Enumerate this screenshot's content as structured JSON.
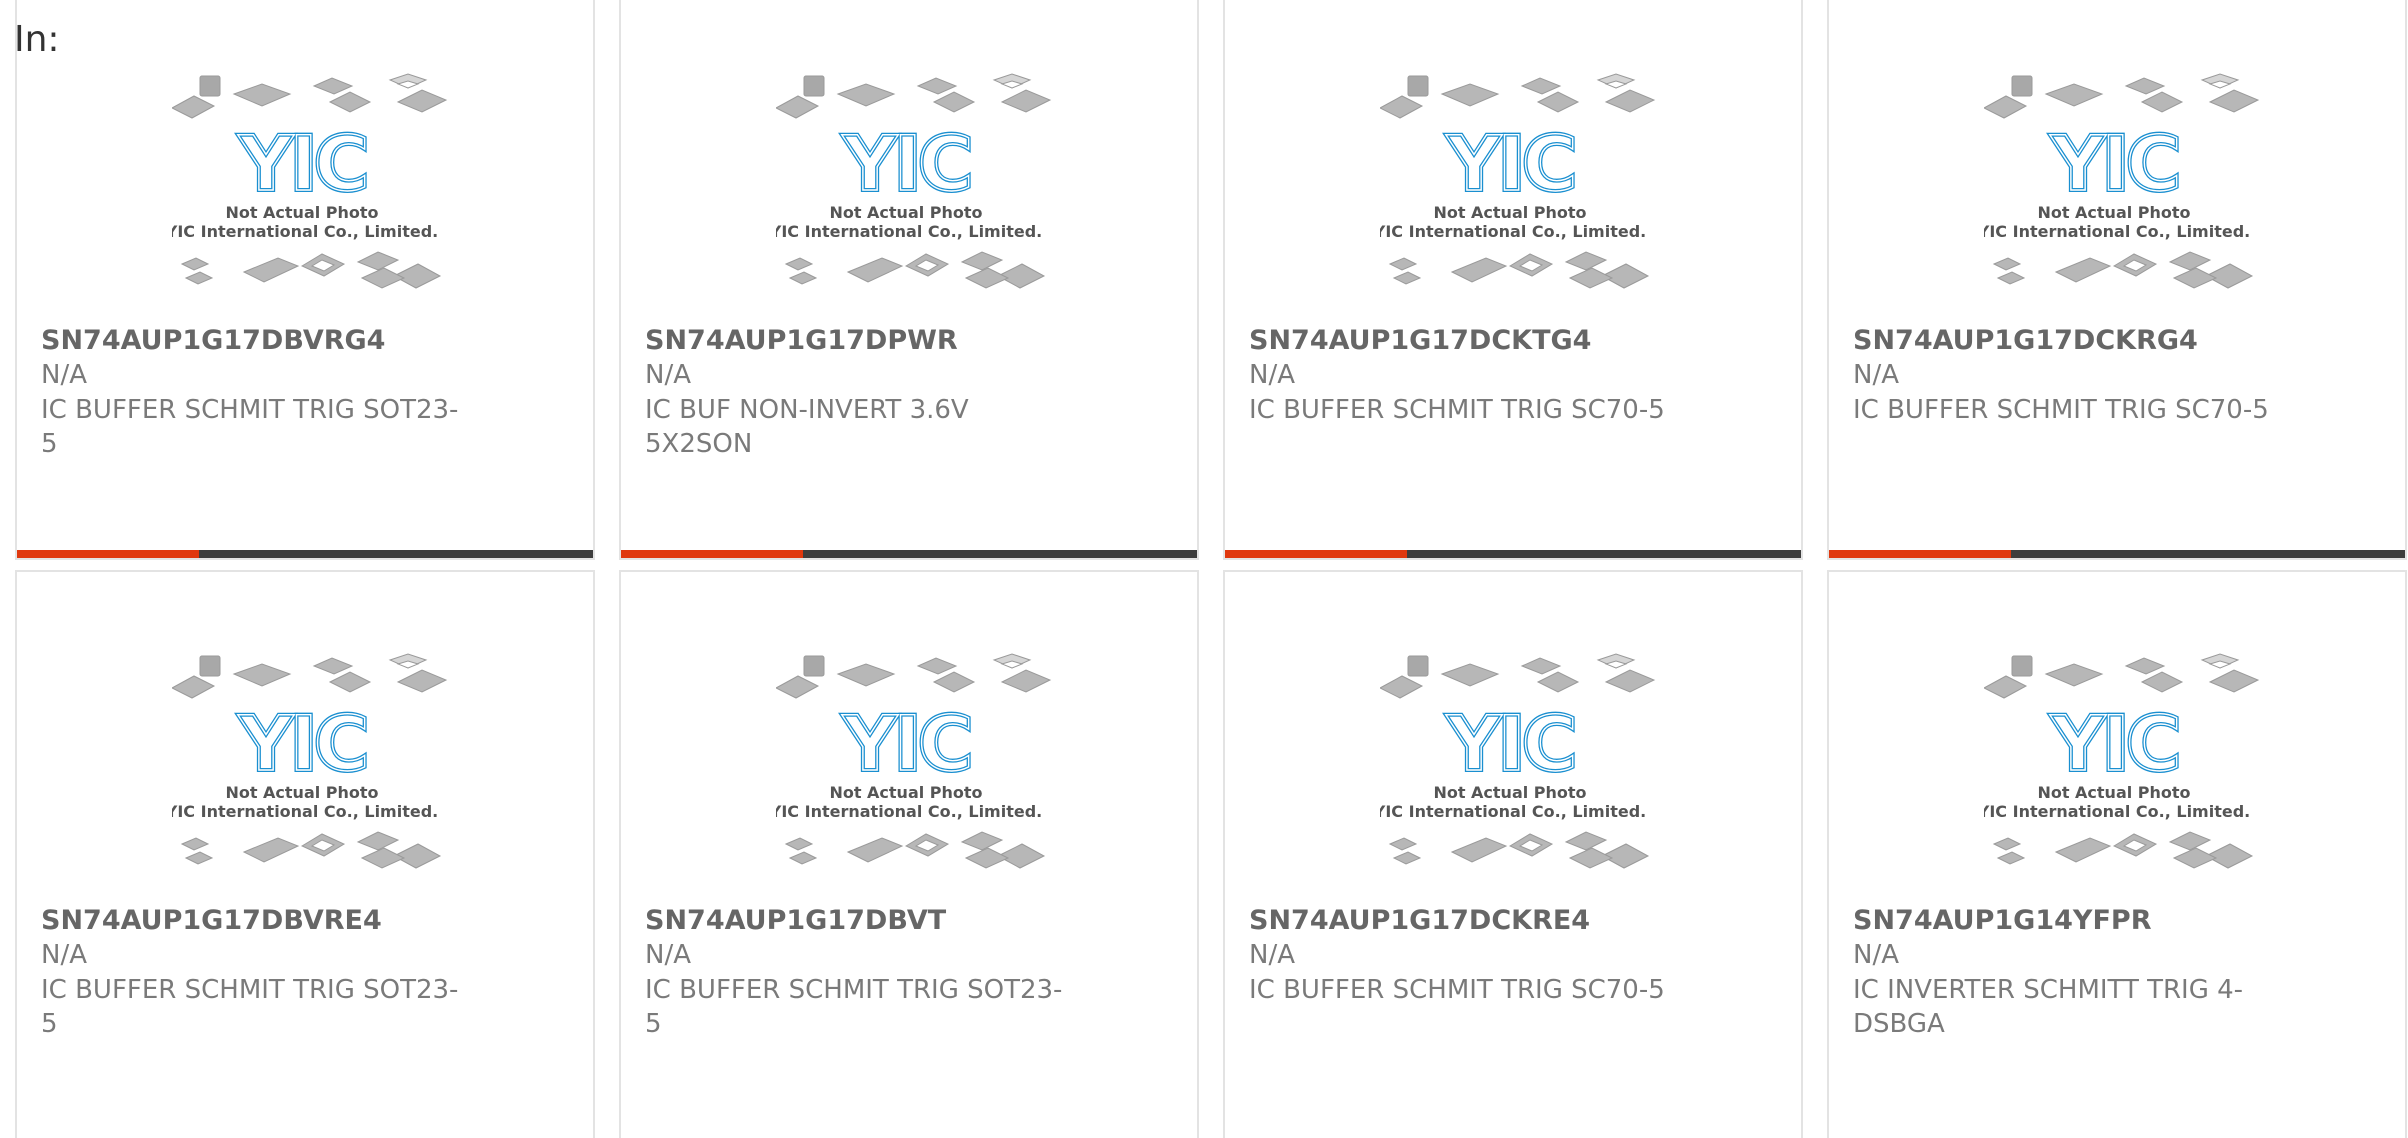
{
  "page": {
    "in_label": "In:"
  },
  "placeholder_image": {
    "caption_line1": "Not Actual Photo",
    "caption_line2": "YIC International Co., Limited.",
    "logo_text": "YIC",
    "logo_color": "#1a8fd0"
  },
  "colors": {
    "accent_bar": "#e0380e",
    "dark_bar": "#3d3d3d",
    "title_text": "#666666",
    "body_text": "#7a7a7a"
  },
  "products": [
    {
      "part_number": "SN74AUP1G17DBVRG4",
      "manufacturer": "N/A",
      "description": "IC BUFFER SCHMIT TRIG SOT23-5"
    },
    {
      "part_number": "SN74AUP1G17DPWR",
      "manufacturer": "N/A",
      "description": "IC BUF NON-INVERT 3.6V 5X2SON"
    },
    {
      "part_number": "SN74AUP1G17DCKTG4",
      "manufacturer": "N/A",
      "description": "IC BUFFER SCHMIT TRIG SC70-5"
    },
    {
      "part_number": "SN74AUP1G17DCKRG4",
      "manufacturer": "N/A",
      "description": "IC BUFFER SCHMIT TRIG SC70-5"
    },
    {
      "part_number": "SN74AUP1G17DBVRE4",
      "manufacturer": "N/A",
      "description": "IC BUFFER SCHMIT TRIG SOT23-5"
    },
    {
      "part_number": "SN74AUP1G17DBVT",
      "manufacturer": "N/A",
      "description": "IC BUFFER SCHMIT TRIG SOT23-5"
    },
    {
      "part_number": "SN74AUP1G17DCKRE4",
      "manufacturer": "N/A",
      "description": "IC BUFFER SCHMIT TRIG SC70-5"
    },
    {
      "part_number": "SN74AUP1G14YFPR",
      "manufacturer": "N/A",
      "description": "IC INVERTER SCHMITT TRIG 4-DSBGA"
    }
  ]
}
